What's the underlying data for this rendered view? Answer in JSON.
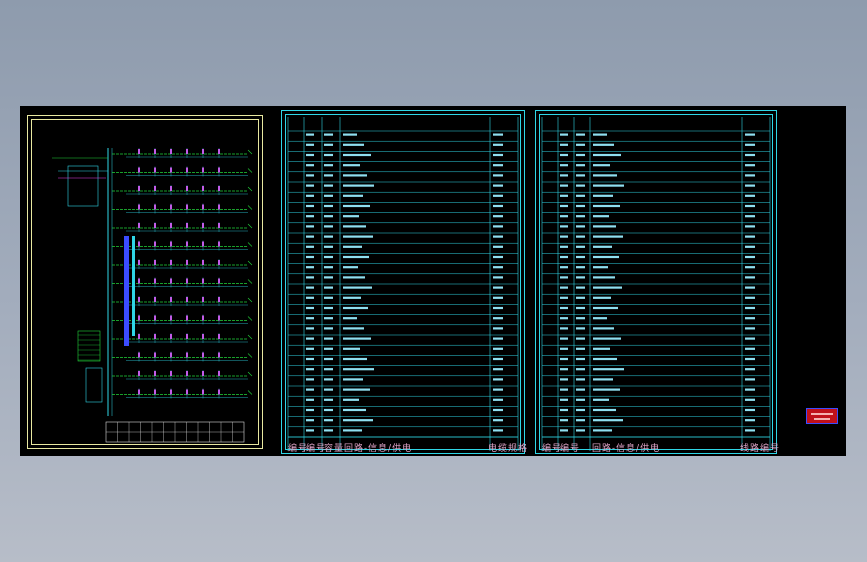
{
  "drawing": {
    "table1_header": [
      "编号",
      "编号",
      "容量",
      "回路-信息/供电",
      "电缆规格"
    ],
    "table2_header": [
      "编号",
      "编号",
      "回路-信息/供电",
      "线路编号"
    ]
  },
  "colors": {
    "background_top": "#8e9bad",
    "canvas": "#000000",
    "border_yellow": "#e8e8a0",
    "cyan": "#2fd6e6",
    "green": "#22d43a",
    "magenta": "#e83ee8",
    "blue": "#3b4cff",
    "label_pink": "#e0a5c8",
    "badge_red": "#c0101a"
  },
  "icons": [
    "title-block-logo-icon"
  ]
}
